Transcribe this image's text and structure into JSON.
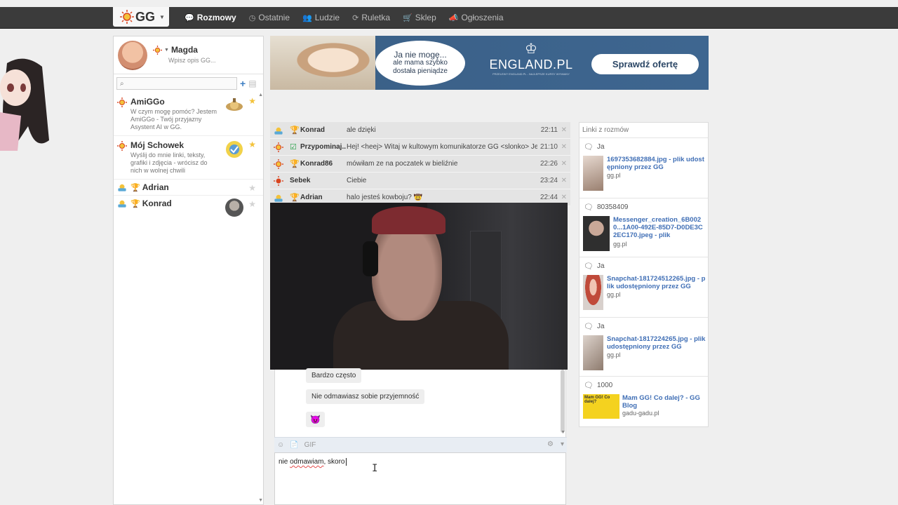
{
  "topbar": {
    "logo": "GG",
    "nav": [
      {
        "label": "Rozmowy",
        "icon": "chat-icon",
        "active": true
      },
      {
        "label": "Ostatnie",
        "icon": "clock-icon",
        "active": false
      },
      {
        "label": "Ludzie",
        "icon": "people-icon",
        "active": false
      },
      {
        "label": "Ruletka",
        "icon": "roulette-icon",
        "active": false
      },
      {
        "label": "Sklep",
        "icon": "cart-icon",
        "active": false
      },
      {
        "label": "Ogłoszenia",
        "icon": "megaphone-icon",
        "active": false
      }
    ]
  },
  "profile": {
    "name": "Magda",
    "description": "Wpisz opis GG..."
  },
  "search": {
    "placeholder": ""
  },
  "contacts": [
    {
      "name": "AmiGGo",
      "description": "W czym mogę pomóc? Jestem AmiGGo - Twój przyjazny Asystent AI w GG.",
      "starred": true
    },
    {
      "name": "Mój Schowek",
      "description": "Wyślij do mnie linki, teksty, grafiki i zdjęcia - wrócisz do nich w wolnej chwili",
      "starred": true
    },
    {
      "name": "Adrian",
      "description": "",
      "starred": false
    },
    {
      "name": "Konrad",
      "description": "",
      "starred": false
    }
  ],
  "banner": {
    "bubble_line1": "Ja nie mogę...",
    "bubble_line2": "ale mama szybko",
    "bubble_line3": "dostała pieniądze",
    "brand": "ENGLAND.PL",
    "brand_sub": "PRZELEWY ENGLAND.PL - NAJLEPSZE KURSY WYMIANY",
    "cta": "Sprawdź ofertę"
  },
  "conversations": [
    {
      "name": "Konrad",
      "message": "ale dzięki ",
      "time": "22:11"
    },
    {
      "name": "Przypominaj...",
      "message": "Hej! <heej> Witaj w kultowym komunikatorze GG <slonko> Jeste",
      "time": "21:10"
    },
    {
      "name": "Konrad86",
      "message": "mówiłam ze na poczatek w bieliźnie",
      "time": "22:26"
    },
    {
      "name": "Sebek",
      "message": "Ciebie",
      "time": "23:24"
    },
    {
      "name": "Adrian",
      "message": "halo jesteś kowboju? 🤠",
      "time": "22:44"
    }
  ],
  "chat": {
    "messages": [
      "Bardzo często",
      "Nie odmawiasz sobie przyjemność",
      "😈"
    ]
  },
  "toolbar": {
    "gif": "GIF"
  },
  "composer": {
    "word_misspelled": "odmawiam",
    "text_before": "nie ",
    "text_after": ", skoro"
  },
  "links": {
    "header": "Linki z rozmów",
    "items": [
      {
        "sender": "Ja",
        "title": "1697353682884.jpg - plik udostępniony przez GG",
        "domain": "gg.pl"
      },
      {
        "sender": "80358409",
        "title": "Messenger_creation_6B0020...1A00-492E-85D7-D0DE3C2EC170.jpeg - plik",
        "domain": "gg.pl"
      },
      {
        "sender": "Ja",
        "title": "Snapchat-181724512265.jpg - plik udostępniony przez GG",
        "domain": "gg.pl"
      },
      {
        "sender": "Ja",
        "title": "Snapchat-1817224265.jpg - plik udostępniony przez GG",
        "domain": "gg.pl"
      },
      {
        "sender": "1000",
        "title": "Mam GG! Co dalej? - GG Blog",
        "domain": "gadu-gadu.pl",
        "thumb_text": "Mam GG! Co dalej?"
      }
    ]
  },
  "colors": {
    "topbar": "#3b3b3b",
    "accent_link": "#3f6eb5",
    "gg_sun": "#f3c23a",
    "banner_bg": "#3e6690"
  }
}
